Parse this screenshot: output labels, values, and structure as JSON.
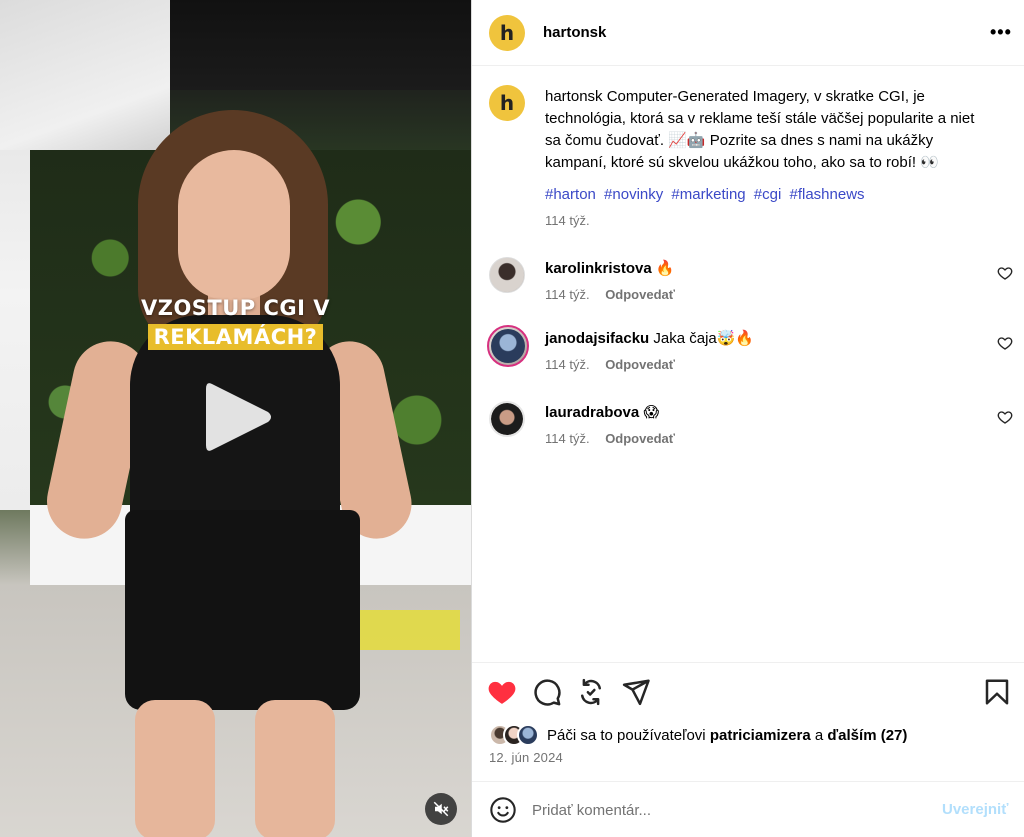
{
  "media": {
    "overlay_line1": "VZOSTUP CGI V",
    "overlay_line2": "REKLAMÁCH?",
    "play_icon": "play-icon",
    "mute_icon": "speaker-muted-icon"
  },
  "header": {
    "avatar_letter": "h",
    "username": "hartonsk",
    "more_label": "•••"
  },
  "caption": {
    "avatar_letter": "h",
    "username": "hartonsk",
    "text": "hartonsk Computer-Generated Imagery, v skratke CGI, je technológia, ktorá sa v reklame teší stále väčšej popularite a niet sa čomu čudovať. 📈🤖 Pozrite sa dnes s nami na ukážky kampaní, ktoré sú skvelou ukážkou toho, ako sa to robí! 👀",
    "hashtags": [
      "#harton",
      "#novinky",
      "#marketing",
      "#cgi",
      "#flashnews"
    ],
    "time": "114 týž."
  },
  "comments": [
    {
      "username": "karolinkristova",
      "text": "🔥",
      "time": "114 týž.",
      "reply": "Odpovedať"
    },
    {
      "username": "janodajsifacku",
      "text": "Jaka čaja🤯🔥",
      "time": "114 týž.",
      "reply": "Odpovedať"
    },
    {
      "username": "lauradrabova",
      "text": "😱",
      "time": "114 týž.",
      "reply": "Odpovedať"
    }
  ],
  "likes": {
    "prefix": "Páči sa to používateľovi",
    "user": "patriciamizera",
    "connector": "a",
    "others": "ďalším (27)"
  },
  "date": "12. jún 2024",
  "comment_input": {
    "placeholder": "Pridať komentár...",
    "post_label": "Uverejniť"
  },
  "colors": {
    "accent_link": "#3b49c7",
    "like_red": "#ff3040",
    "brand_yellow": "#f0c43d",
    "post_disabled": "#b2dffc"
  }
}
